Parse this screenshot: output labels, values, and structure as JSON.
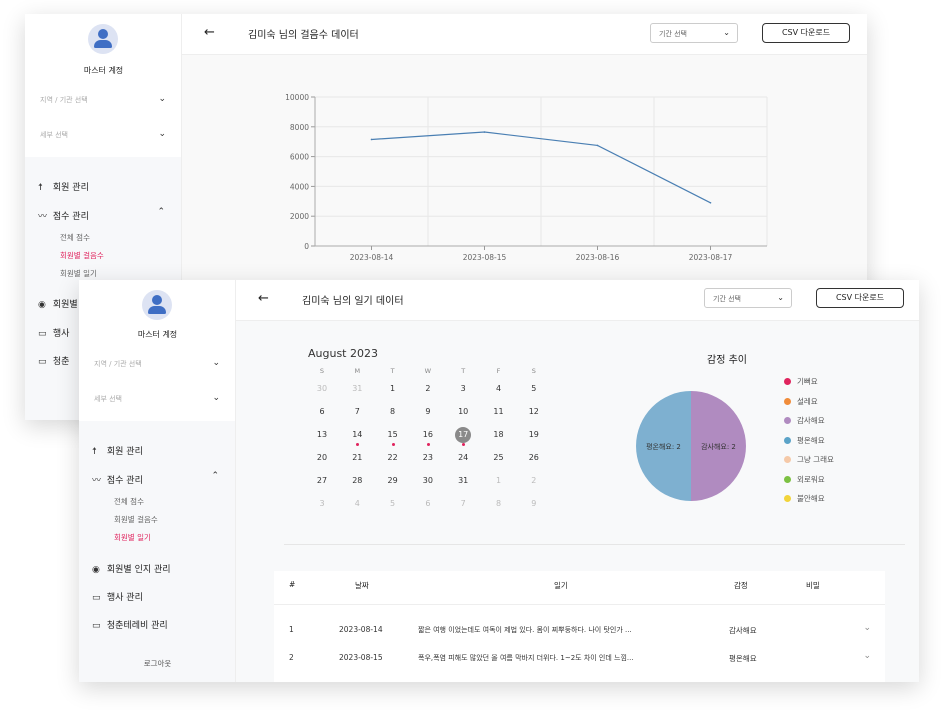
{
  "back_window": {
    "sidebar": {
      "account_name": "마스터 계정",
      "region_select": "지역 / 기관 선택",
      "detail_select": "세부 선택",
      "menu": [
        "회원 관리",
        "점수 관리",
        "회원별",
        "행사",
        "청춘"
      ],
      "submenu": [
        "전체 점수",
        "회원별 걸음수",
        "회원별 일기"
      ]
    },
    "header": {
      "title": "김미숙 님의 걸음수 데이터",
      "period_placeholder": "기간 선택",
      "csv_label": "CSV 다운로드"
    },
    "chart_data": {
      "type": "line",
      "x": [
        "2023-08-14",
        "2023-08-15",
        "2023-08-16",
        "2023-08-17"
      ],
      "values": [
        7150,
        7650,
        6750,
        2900
      ],
      "y_ticks": [
        "0",
        "2000",
        "4000",
        "6000",
        "8000",
        "10000"
      ],
      "ylim": [
        0,
        10000
      ],
      "line_color": "#4a7fb3",
      "grid": true
    }
  },
  "front_window": {
    "sidebar": {
      "account_name": "마스터 계정",
      "region_select": "지역 / 기관 선택",
      "detail_select": "세부 선택",
      "menu": [
        "회원 관리",
        "점수 관리",
        "회원별 인지 관리",
        "행사 관리",
        "청춘테레비 관리"
      ],
      "submenu": [
        "전체 점수",
        "회원별 걸음수",
        "회원별 일기"
      ],
      "logout": "로그아웃"
    },
    "header": {
      "title": "김미숙 님의 일기 데이터",
      "period_placeholder": "기간 선택",
      "csv_label": "CSV 다운로드"
    },
    "calendar": {
      "month_label": "August 2023",
      "weekdays": [
        "S",
        "M",
        "T",
        "W",
        "T",
        "F",
        "S"
      ],
      "weeks": [
        [
          "30",
          "31",
          "1",
          "2",
          "3",
          "4",
          "5"
        ],
        [
          "6",
          "7",
          "8",
          "9",
          "10",
          "11",
          "12"
        ],
        [
          "13",
          "14",
          "15",
          "16",
          "17",
          "18",
          "19"
        ],
        [
          "20",
          "21",
          "22",
          "23",
          "24",
          "25",
          "26"
        ],
        [
          "27",
          "28",
          "29",
          "30",
          "31",
          "1",
          "2"
        ],
        [
          "3",
          "4",
          "5",
          "6",
          "7",
          "8",
          "9"
        ]
      ],
      "selected_day": "17",
      "marked_days": [
        "14",
        "15",
        "16",
        "17"
      ]
    },
    "emotion": {
      "title": "감정 추이",
      "chart_data": {
        "type": "pie",
        "slices": [
          {
            "label": "평온해요: 2",
            "value": 2,
            "color": "#7eb0d0"
          },
          {
            "label": "감사해요: 2",
            "value": 2,
            "color": "#b08bc0"
          }
        ]
      },
      "legend": [
        {
          "label": "기뻐요",
          "color": "#e0245e"
        },
        {
          "label": "설레요",
          "color": "#f08c3a"
        },
        {
          "label": "감사해요",
          "color": "#b08bc0"
        },
        {
          "label": "평온해요",
          "color": "#5ba3c8"
        },
        {
          "label": "그냥 그래요",
          "color": "#f5c9a8"
        },
        {
          "label": "외로워요",
          "color": "#7cc142"
        },
        {
          "label": "불안해요",
          "color": "#f2d43a"
        }
      ]
    },
    "table": {
      "headers": [
        "#",
        "날짜",
        "일기",
        "감정",
        "비밀"
      ],
      "rows": [
        {
          "no": "1",
          "date": "2023-08-14",
          "diary": "짧은 여행 이었는데도 여독이 제법 있다. 몸이 찌뿌둥하다. 나이 탓인가 ...",
          "emotion": "감사해요"
        },
        {
          "no": "2",
          "date": "2023-08-15",
          "diary": "폭우,폭염 피해도 많았던 올 여름 막바지 더위다. 1~2도 차이 인데 느낌...",
          "emotion": "평온해요"
        }
      ]
    }
  }
}
